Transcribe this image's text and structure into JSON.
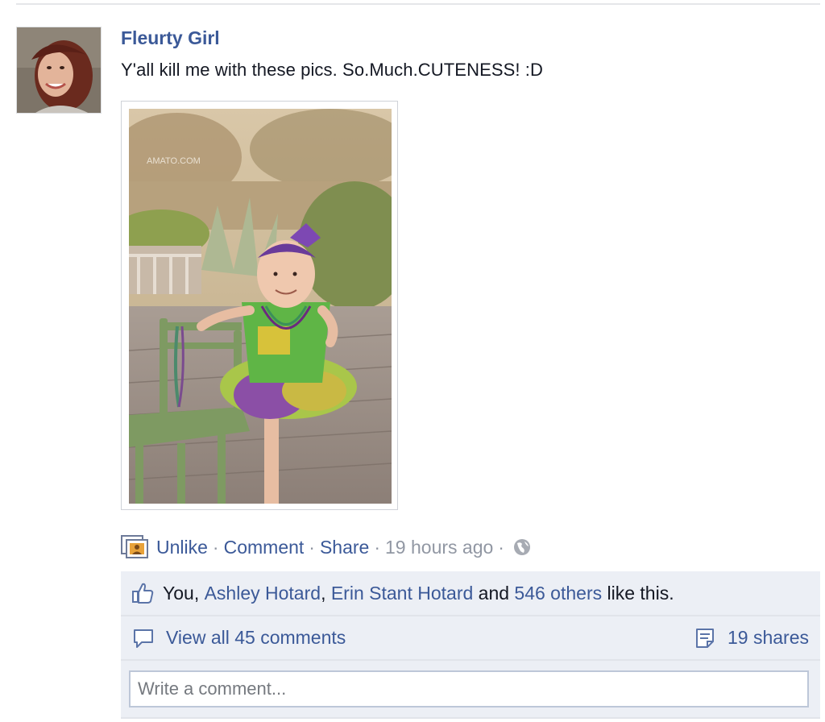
{
  "post": {
    "author": "Fleurty Girl",
    "message": "Y'all kill me with these pics. So.Much.CUTENESS! :D",
    "photo_watermark": "AMATO.COM"
  },
  "actions": {
    "unlike_label": "Unlike",
    "comment_label": "Comment",
    "share_label": "Share",
    "separator": "·",
    "timestamp": "19 hours ago",
    "privacy_icon": "globe-icon"
  },
  "likes": {
    "prefix": "You, ",
    "friend_1": "Ashley Hotard",
    "comma": ", ",
    "friend_2": "Erin Stant Hotard",
    "and": " and ",
    "others": "546 others",
    "suffix": " like this."
  },
  "comments": {
    "view_all_label": "View all 45 comments",
    "shares_label": "19 shares"
  },
  "composer": {
    "placeholder": "Write a comment..."
  },
  "colors": {
    "link": "#3b5998",
    "meta": "#9197a3",
    "ufi_background": "#eceff5"
  }
}
